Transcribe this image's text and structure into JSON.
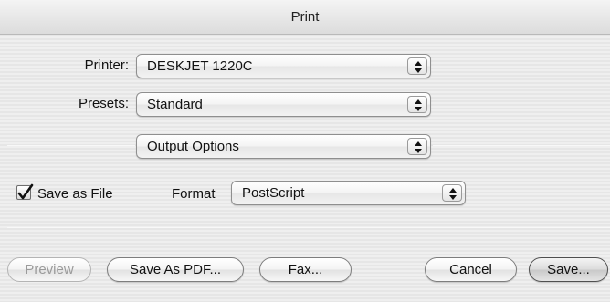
{
  "window": {
    "title": "Print"
  },
  "printer": {
    "label": "Printer:",
    "value": "DESKJET 1220C"
  },
  "presets": {
    "label": "Presets:",
    "value": "Standard"
  },
  "pane": {
    "value": "Output Options"
  },
  "save_as_file": {
    "label": "Save as File",
    "checked": true
  },
  "format": {
    "label": "Format",
    "value": "PostScript"
  },
  "buttons": {
    "preview": "Preview",
    "save_as_pdf": "Save As PDF...",
    "fax": "Fax...",
    "cancel": "Cancel",
    "save": "Save..."
  },
  "icons": {
    "popup_arrows": "up-down-arrows-icon",
    "checkmark": "checkmark-icon"
  }
}
